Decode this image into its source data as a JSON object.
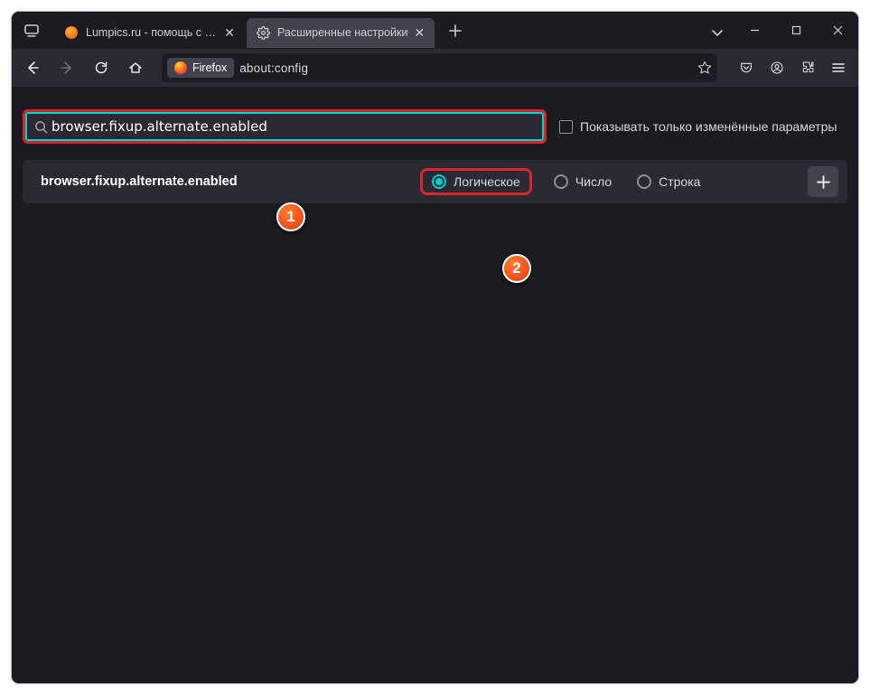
{
  "titlebar": {
    "tabs": [
      {
        "label": "Lumpics.ru - помощь с компь"
      },
      {
        "label": "Расширенные настройки"
      }
    ]
  },
  "toolbar": {
    "firefox_chip": "Firefox",
    "url": "about:config"
  },
  "config": {
    "search_value": "browser.fixup.alternate.enabled",
    "show_modified_label": "Показывать только изменённые параметры",
    "pref_name": "browser.fixup.alternate.enabled",
    "radios": {
      "boolean": "Логическое",
      "number": "Число",
      "string": "Строка"
    }
  },
  "callouts": {
    "one": "1",
    "two": "2"
  }
}
